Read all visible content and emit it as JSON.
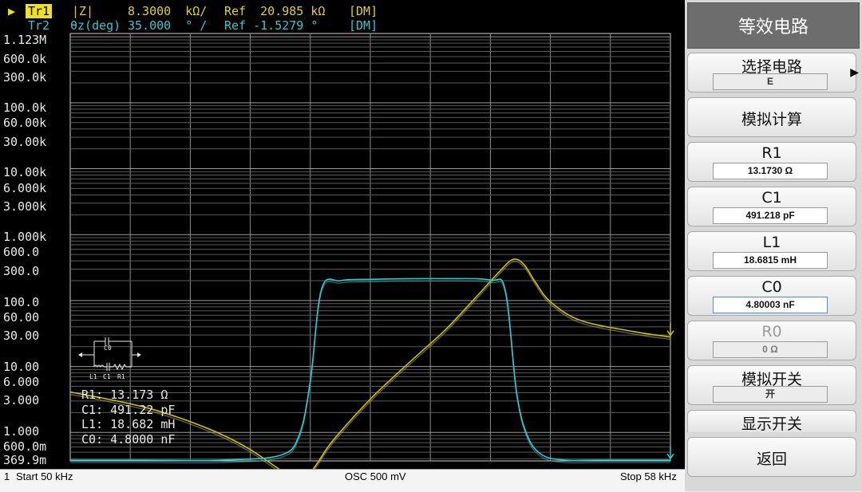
{
  "header": {
    "tr1_marker": "▶",
    "tr1_name": "Tr1",
    "tr1_format": "|Z|",
    "tr1_scale": "8.3000  kΩ/",
    "tr1_ref": "Ref  20.985 kΩ",
    "tr1_mode": "[DM]",
    "tr2_name": "Tr2",
    "tr2_format": "θz(deg)",
    "tr2_scale": "35.000  ° /",
    "tr2_ref": "Ref -1.5279 °",
    "tr2_mode": "[DM]"
  },
  "y_axis_labels": [
    "1.123M",
    "600.0k",
    "300.0k",
    "100.0k",
    "60.00k",
    "30.00k",
    "10.00k",
    "6.000k",
    "3.000k",
    "1.000k",
    "600.0",
    "300.0",
    "100.0",
    "60.00",
    "30.00",
    "10.00",
    "6.000",
    "3.000",
    "1.000",
    "600.0m",
    "369.9m"
  ],
  "circuit_info": {
    "r1": "R1: 13.173 Ω",
    "c1": "C1: 491.22 pF",
    "l1": "L1: 18.682 mH",
    "c0": "C0: 4.8000 nF",
    "schematic_c0": "C0",
    "schematic_l1": "L1",
    "schematic_c1": "C1",
    "schematic_r1": "R1"
  },
  "status_bar": {
    "channel": "1",
    "start": "Start  50 kHz",
    "osc": "OSC 500 mV",
    "stop": "Stop  58 kHz"
  },
  "panel": {
    "title": "等效电路",
    "select_circuit_label": "选择电路",
    "select_circuit_value": "E",
    "simulate_label": "模拟计算",
    "r1_label": "R1",
    "r1_value": "13.1730 Ω",
    "c1_label": "C1",
    "c1_value": "491.218 pF",
    "l1_label": "L1",
    "l1_value": "18.6815 mH",
    "c0_label": "C0",
    "c0_value": "4.80003 nF",
    "r0_label": "R0",
    "r0_value": "0 Ω",
    "sim_switch_label": "模拟开关",
    "sim_switch_value": "开",
    "display_switch_label": "显示开关",
    "back_label": "返回"
  },
  "chart_data": {
    "type": "line",
    "x_range_khz": [
      50,
      58
    ],
    "y_scale": "log",
    "ylim": [
      0.3699,
      1123000
    ],
    "grid": true,
    "colors": {
      "tr1": "#c8c020",
      "tr2": "#30c8d0"
    },
    "series": [
      {
        "name": "Tr1",
        "x": [
          50,
          50.5,
          51,
          51.5,
          52,
          52.4,
          52.8,
          53,
          53.15,
          53.3,
          53.5,
          54,
          54.5,
          55,
          55.4,
          55.7,
          55.9,
          56.05,
          56.2,
          56.4,
          56.8,
          57.5,
          58
        ],
        "y": [
          4.1,
          3.2,
          2.4,
          1.6,
          0.95,
          0.55,
          0.27,
          0.2,
          0.21,
          0.35,
          0.75,
          3.2,
          11,
          36,
          110,
          260,
          420,
          350,
          190,
          96,
          50,
          34,
          28
        ]
      },
      {
        "name": "Tr2",
        "x": [
          50,
          51,
          52,
          52.8,
          53.05,
          53.2,
          53.35,
          53.6,
          54,
          55,
          55.6,
          55.8,
          55.95,
          56.1,
          56.3,
          56.6,
          57,
          57.5,
          58
        ],
        "y": [
          0.38,
          0.38,
          0.38,
          0.45,
          0.9,
          6,
          150,
          200,
          210,
          215,
          205,
          140,
          4,
          0.85,
          0.45,
          0.38,
          0.38,
          0.38,
          0.38
        ]
      }
    ]
  }
}
